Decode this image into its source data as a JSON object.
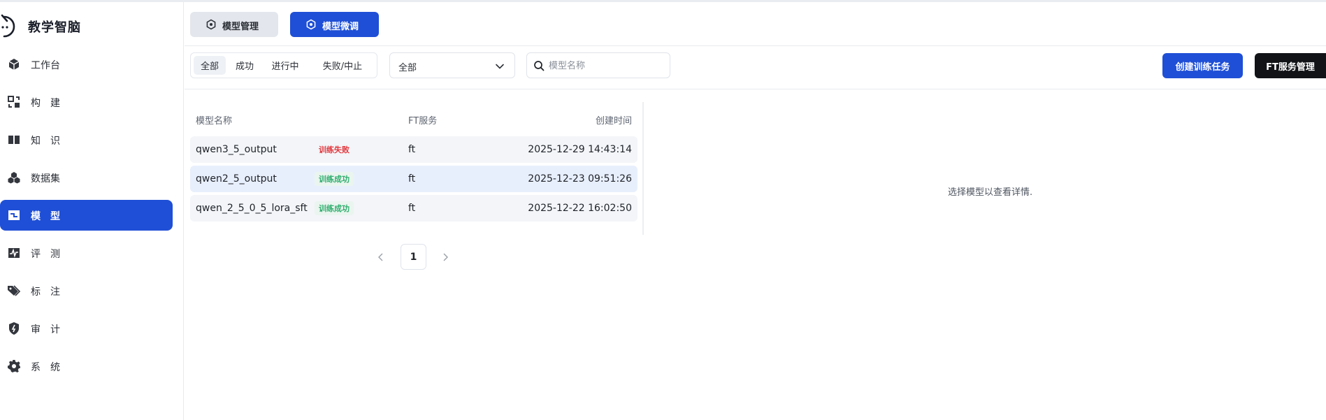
{
  "brand": {
    "name": "教学智脑",
    "logo_icon": "brand-logo-icon"
  },
  "sidebar": {
    "items": [
      {
        "label": "工作台",
        "icon": "cube-icon"
      },
      {
        "label": "构　建",
        "icon": "build-icon"
      },
      {
        "label": "知　识",
        "icon": "book-icon"
      },
      {
        "label": "数据集",
        "icon": "dataset-icon"
      },
      {
        "label": "模　型",
        "icon": "model-icon",
        "active": true
      },
      {
        "label": "评　测",
        "icon": "pulse-icon"
      },
      {
        "label": "标　注",
        "icon": "tag-icon"
      },
      {
        "label": "审　计",
        "icon": "shield-icon"
      },
      {
        "label": "系　统",
        "icon": "gear-icon"
      }
    ]
  },
  "top_tabs": {
    "manage_label": "模型管理",
    "finetune_label": "模型微调",
    "active": "模型微调"
  },
  "toolbar": {
    "status_filters": [
      "全部",
      "成功",
      "进行中",
      "失败/中止"
    ],
    "active_filter": "全部",
    "select_value": "全部",
    "search_placeholder": "模型名称",
    "create_label": "创建训练任务",
    "ft_manage_label": "FT服务管理"
  },
  "table": {
    "columns": {
      "name": "模型名称",
      "ft": "FT服务",
      "time": "创建时间"
    },
    "rows": [
      {
        "name": "qwen3_5_output",
        "status": "训练失败",
        "status_type": "fail",
        "ft": "ft",
        "time": "2025-12-29 14:43:14"
      },
      {
        "name": "qwen2_5_output",
        "status": "训练成功",
        "status_type": "ok",
        "ft": "ft",
        "time": "2025-12-23 09:51:26",
        "selected": true
      },
      {
        "name": "qwen_2_5_0_5_lora_sft",
        "status": "训练成功",
        "status_type": "ok",
        "ft": "ft",
        "time": "2025-12-22 16:02:50"
      }
    ]
  },
  "pagination": {
    "current": "1"
  },
  "detail": {
    "empty_message": "选择模型以查看详情."
  },
  "colors": {
    "accent": "#1f4fd6",
    "fail": "#e2363c",
    "success": "#2fae6e",
    "dark_button": "#111317"
  }
}
